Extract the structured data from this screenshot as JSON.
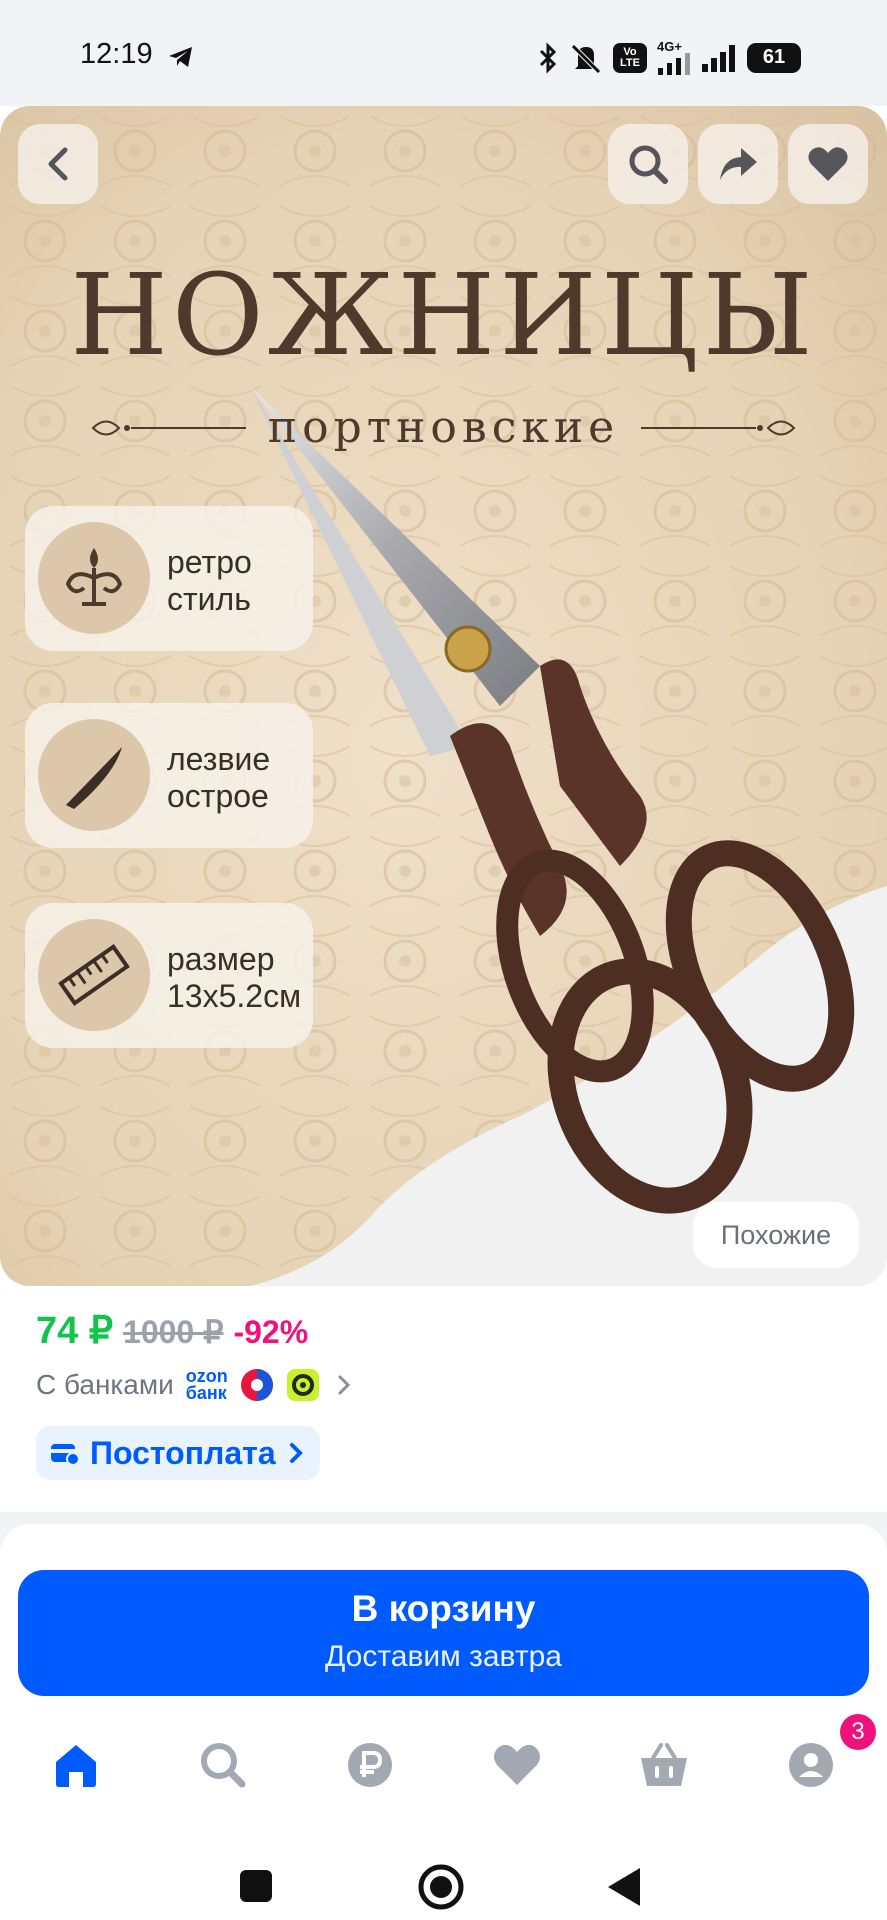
{
  "status_bar": {
    "time": "12:19",
    "network": "4G+",
    "volte": "Vo LTE",
    "battery": "61"
  },
  "product_image": {
    "title": "НОЖНИЦЫ",
    "subtitle": "портновские",
    "features": [
      {
        "icon": "ornament-icon",
        "line1": "ретро",
        "line2": "стиль"
      },
      {
        "icon": "blade-icon",
        "line1": "лезвие",
        "line2": "острое"
      },
      {
        "icon": "ruler-icon",
        "line1": "размер",
        "line2": "13x5.2см"
      }
    ],
    "similar_label": "Похожие"
  },
  "price": {
    "current": "74 ₽",
    "old": "1000 ₽",
    "discount": "-92%",
    "banks_label": "С банками",
    "ozon_bank_line1": "ozon",
    "ozon_bank_line2": "банк",
    "postpay_label": "Постоплата"
  },
  "cart_button": {
    "label": "В корзину",
    "sublabel": "Доставим завтра"
  },
  "bottom_nav": {
    "items": [
      "home-icon",
      "search-icon",
      "ruble-icon",
      "heart-icon",
      "basket-icon",
      "profile-icon"
    ],
    "profile_badge": "3"
  },
  "colors": {
    "accent": "#005bff",
    "price_green": "#10c44c",
    "discount_pink": "#f1117e",
    "title_brown": "#4e3a2d"
  }
}
